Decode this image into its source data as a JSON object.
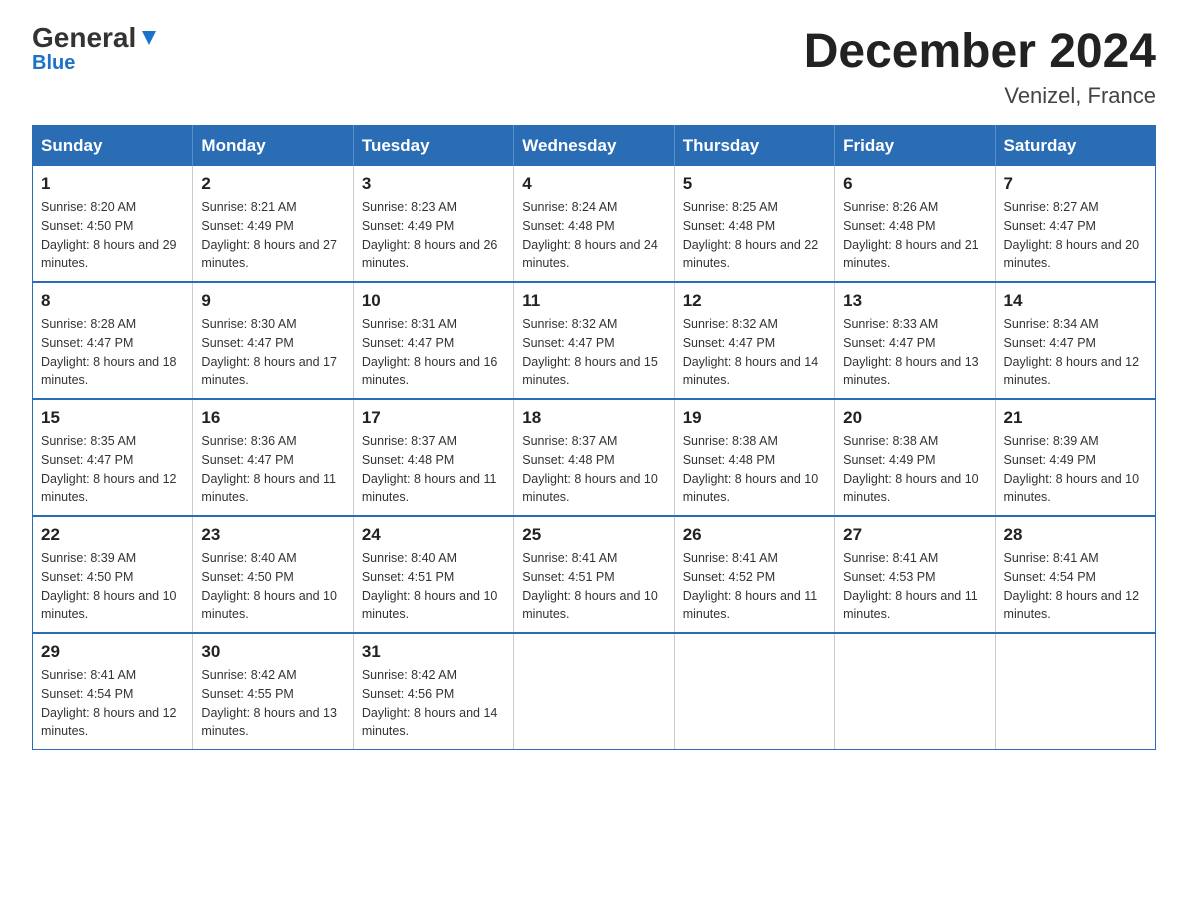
{
  "logo": {
    "general": "General",
    "blue": "Blue"
  },
  "title": "December 2024",
  "subtitle": "Venizel, France",
  "days_header": [
    "Sunday",
    "Monday",
    "Tuesday",
    "Wednesday",
    "Thursday",
    "Friday",
    "Saturday"
  ],
  "weeks": [
    [
      {
        "day": "1",
        "sunrise": "8:20 AM",
        "sunset": "4:50 PM",
        "daylight": "8 hours and 29 minutes."
      },
      {
        "day": "2",
        "sunrise": "8:21 AM",
        "sunset": "4:49 PM",
        "daylight": "8 hours and 27 minutes."
      },
      {
        "day": "3",
        "sunrise": "8:23 AM",
        "sunset": "4:49 PM",
        "daylight": "8 hours and 26 minutes."
      },
      {
        "day": "4",
        "sunrise": "8:24 AM",
        "sunset": "4:48 PM",
        "daylight": "8 hours and 24 minutes."
      },
      {
        "day": "5",
        "sunrise": "8:25 AM",
        "sunset": "4:48 PM",
        "daylight": "8 hours and 22 minutes."
      },
      {
        "day": "6",
        "sunrise": "8:26 AM",
        "sunset": "4:48 PM",
        "daylight": "8 hours and 21 minutes."
      },
      {
        "day": "7",
        "sunrise": "8:27 AM",
        "sunset": "4:47 PM",
        "daylight": "8 hours and 20 minutes."
      }
    ],
    [
      {
        "day": "8",
        "sunrise": "8:28 AM",
        "sunset": "4:47 PM",
        "daylight": "8 hours and 18 minutes."
      },
      {
        "day": "9",
        "sunrise": "8:30 AM",
        "sunset": "4:47 PM",
        "daylight": "8 hours and 17 minutes."
      },
      {
        "day": "10",
        "sunrise": "8:31 AM",
        "sunset": "4:47 PM",
        "daylight": "8 hours and 16 minutes."
      },
      {
        "day": "11",
        "sunrise": "8:32 AM",
        "sunset": "4:47 PM",
        "daylight": "8 hours and 15 minutes."
      },
      {
        "day": "12",
        "sunrise": "8:32 AM",
        "sunset": "4:47 PM",
        "daylight": "8 hours and 14 minutes."
      },
      {
        "day": "13",
        "sunrise": "8:33 AM",
        "sunset": "4:47 PM",
        "daylight": "8 hours and 13 minutes."
      },
      {
        "day": "14",
        "sunrise": "8:34 AM",
        "sunset": "4:47 PM",
        "daylight": "8 hours and 12 minutes."
      }
    ],
    [
      {
        "day": "15",
        "sunrise": "8:35 AM",
        "sunset": "4:47 PM",
        "daylight": "8 hours and 12 minutes."
      },
      {
        "day": "16",
        "sunrise": "8:36 AM",
        "sunset": "4:47 PM",
        "daylight": "8 hours and 11 minutes."
      },
      {
        "day": "17",
        "sunrise": "8:37 AM",
        "sunset": "4:48 PM",
        "daylight": "8 hours and 11 minutes."
      },
      {
        "day": "18",
        "sunrise": "8:37 AM",
        "sunset": "4:48 PM",
        "daylight": "8 hours and 10 minutes."
      },
      {
        "day": "19",
        "sunrise": "8:38 AM",
        "sunset": "4:48 PM",
        "daylight": "8 hours and 10 minutes."
      },
      {
        "day": "20",
        "sunrise": "8:38 AM",
        "sunset": "4:49 PM",
        "daylight": "8 hours and 10 minutes."
      },
      {
        "day": "21",
        "sunrise": "8:39 AM",
        "sunset": "4:49 PM",
        "daylight": "8 hours and 10 minutes."
      }
    ],
    [
      {
        "day": "22",
        "sunrise": "8:39 AM",
        "sunset": "4:50 PM",
        "daylight": "8 hours and 10 minutes."
      },
      {
        "day": "23",
        "sunrise": "8:40 AM",
        "sunset": "4:50 PM",
        "daylight": "8 hours and 10 minutes."
      },
      {
        "day": "24",
        "sunrise": "8:40 AM",
        "sunset": "4:51 PM",
        "daylight": "8 hours and 10 minutes."
      },
      {
        "day": "25",
        "sunrise": "8:41 AM",
        "sunset": "4:51 PM",
        "daylight": "8 hours and 10 minutes."
      },
      {
        "day": "26",
        "sunrise": "8:41 AM",
        "sunset": "4:52 PM",
        "daylight": "8 hours and 11 minutes."
      },
      {
        "day": "27",
        "sunrise": "8:41 AM",
        "sunset": "4:53 PM",
        "daylight": "8 hours and 11 minutes."
      },
      {
        "day": "28",
        "sunrise": "8:41 AM",
        "sunset": "4:54 PM",
        "daylight": "8 hours and 12 minutes."
      }
    ],
    [
      {
        "day": "29",
        "sunrise": "8:41 AM",
        "sunset": "4:54 PM",
        "daylight": "8 hours and 12 minutes."
      },
      {
        "day": "30",
        "sunrise": "8:42 AM",
        "sunset": "4:55 PM",
        "daylight": "8 hours and 13 minutes."
      },
      {
        "day": "31",
        "sunrise": "8:42 AM",
        "sunset": "4:56 PM",
        "daylight": "8 hours and 14 minutes."
      },
      null,
      null,
      null,
      null
    ]
  ]
}
